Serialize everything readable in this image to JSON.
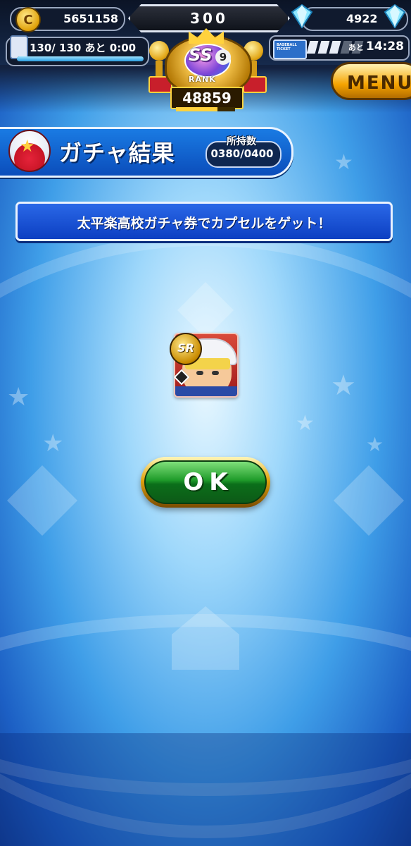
{
  "hud": {
    "coins": "5651158",
    "center_counter": "300",
    "gems": "4922",
    "stamina": "130/ 130 あと  0:00",
    "stamina_fraction": 1.0,
    "ticket_label": "BASEBALL TICKET",
    "ticket_time_prefix": "あと",
    "ticket_time": "14:28",
    "rank_grade": "SS",
    "rank_level": "9",
    "rank_label": "RANK",
    "rank_score": "48859",
    "menu_label": "MENU"
  },
  "header": {
    "title": "ガチャ結果",
    "owned_label": "所持数",
    "owned_value": "0380/0400"
  },
  "message": "太平楽高校ガチャ券でカプセルをゲット！",
  "result_card": {
    "rarity": "SR"
  },
  "ok_button": {
    "label": "OK"
  },
  "colors": {
    "accent_blue": "#0b4dbb",
    "ok_green": "#1f9b2a",
    "gold": "#e2a410"
  }
}
